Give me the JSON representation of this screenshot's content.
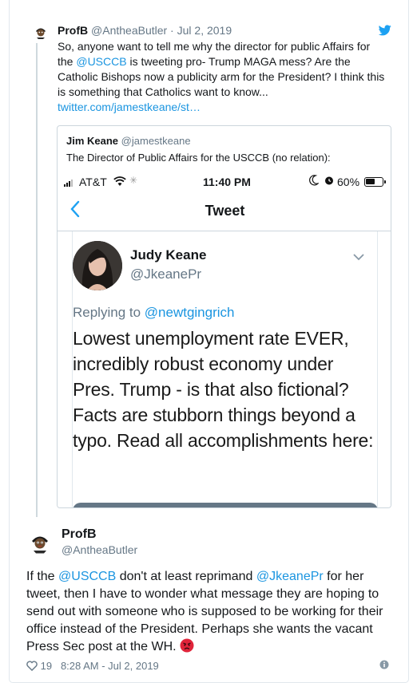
{
  "parent": {
    "name": "ProfB",
    "handle": "@AntheaButler",
    "separator": " · ",
    "date": "Jul 2, 2019",
    "text_parts": [
      "So, anyone want to tell me why the director for public Affairs for the ",
      "@USCCB",
      " is tweeting pro- Trump MAGA mess? Are the Catholic Bishops now a publicity arm for the President? I think this is something that Catholics want to know... ",
      "twitter.com/jamestkeane/st…"
    ]
  },
  "quote": {
    "name": "Jim Keane",
    "handle": "@jamestkeane",
    "text": "The Director of Public Affairs for the USCCB (no relation):"
  },
  "phone": {
    "carrier": "AT&T",
    "time": "11:40 PM",
    "battery_text": "60%",
    "battery_level": 0.6,
    "nav_title": "Tweet",
    "back_icon": "<",
    "inner_name": "Judy Keane",
    "inner_handle": "@JkeanePr",
    "replying_prefix": "Replying to ",
    "replying_handle": "@newtgingrich",
    "inner_text": "Lowest unemployment rate EVER, incredibly robust economy under Pres. Trump - is that also fictional? Facts are stubborn things beyond a typo. Read all accomplishments here:"
  },
  "main": {
    "name": "ProfB",
    "handle": "@AntheaButler",
    "text_parts": [
      "If the ",
      "@USCCB",
      "  don't at least reprimand ",
      "@JkeanePr",
      " for her tweet, then I have to wonder what message they are hoping to send out with someone who is supposed to be working for their office instead of the President. Perhaps she wants the vacant Press Sec post at the WH."
    ],
    "likes": "19",
    "timestamp": "8:28 AM - Jul 2, 2019"
  },
  "colors": {
    "link": "#1b95e0",
    "muted": "#657786",
    "brand": "#1da1f2"
  }
}
